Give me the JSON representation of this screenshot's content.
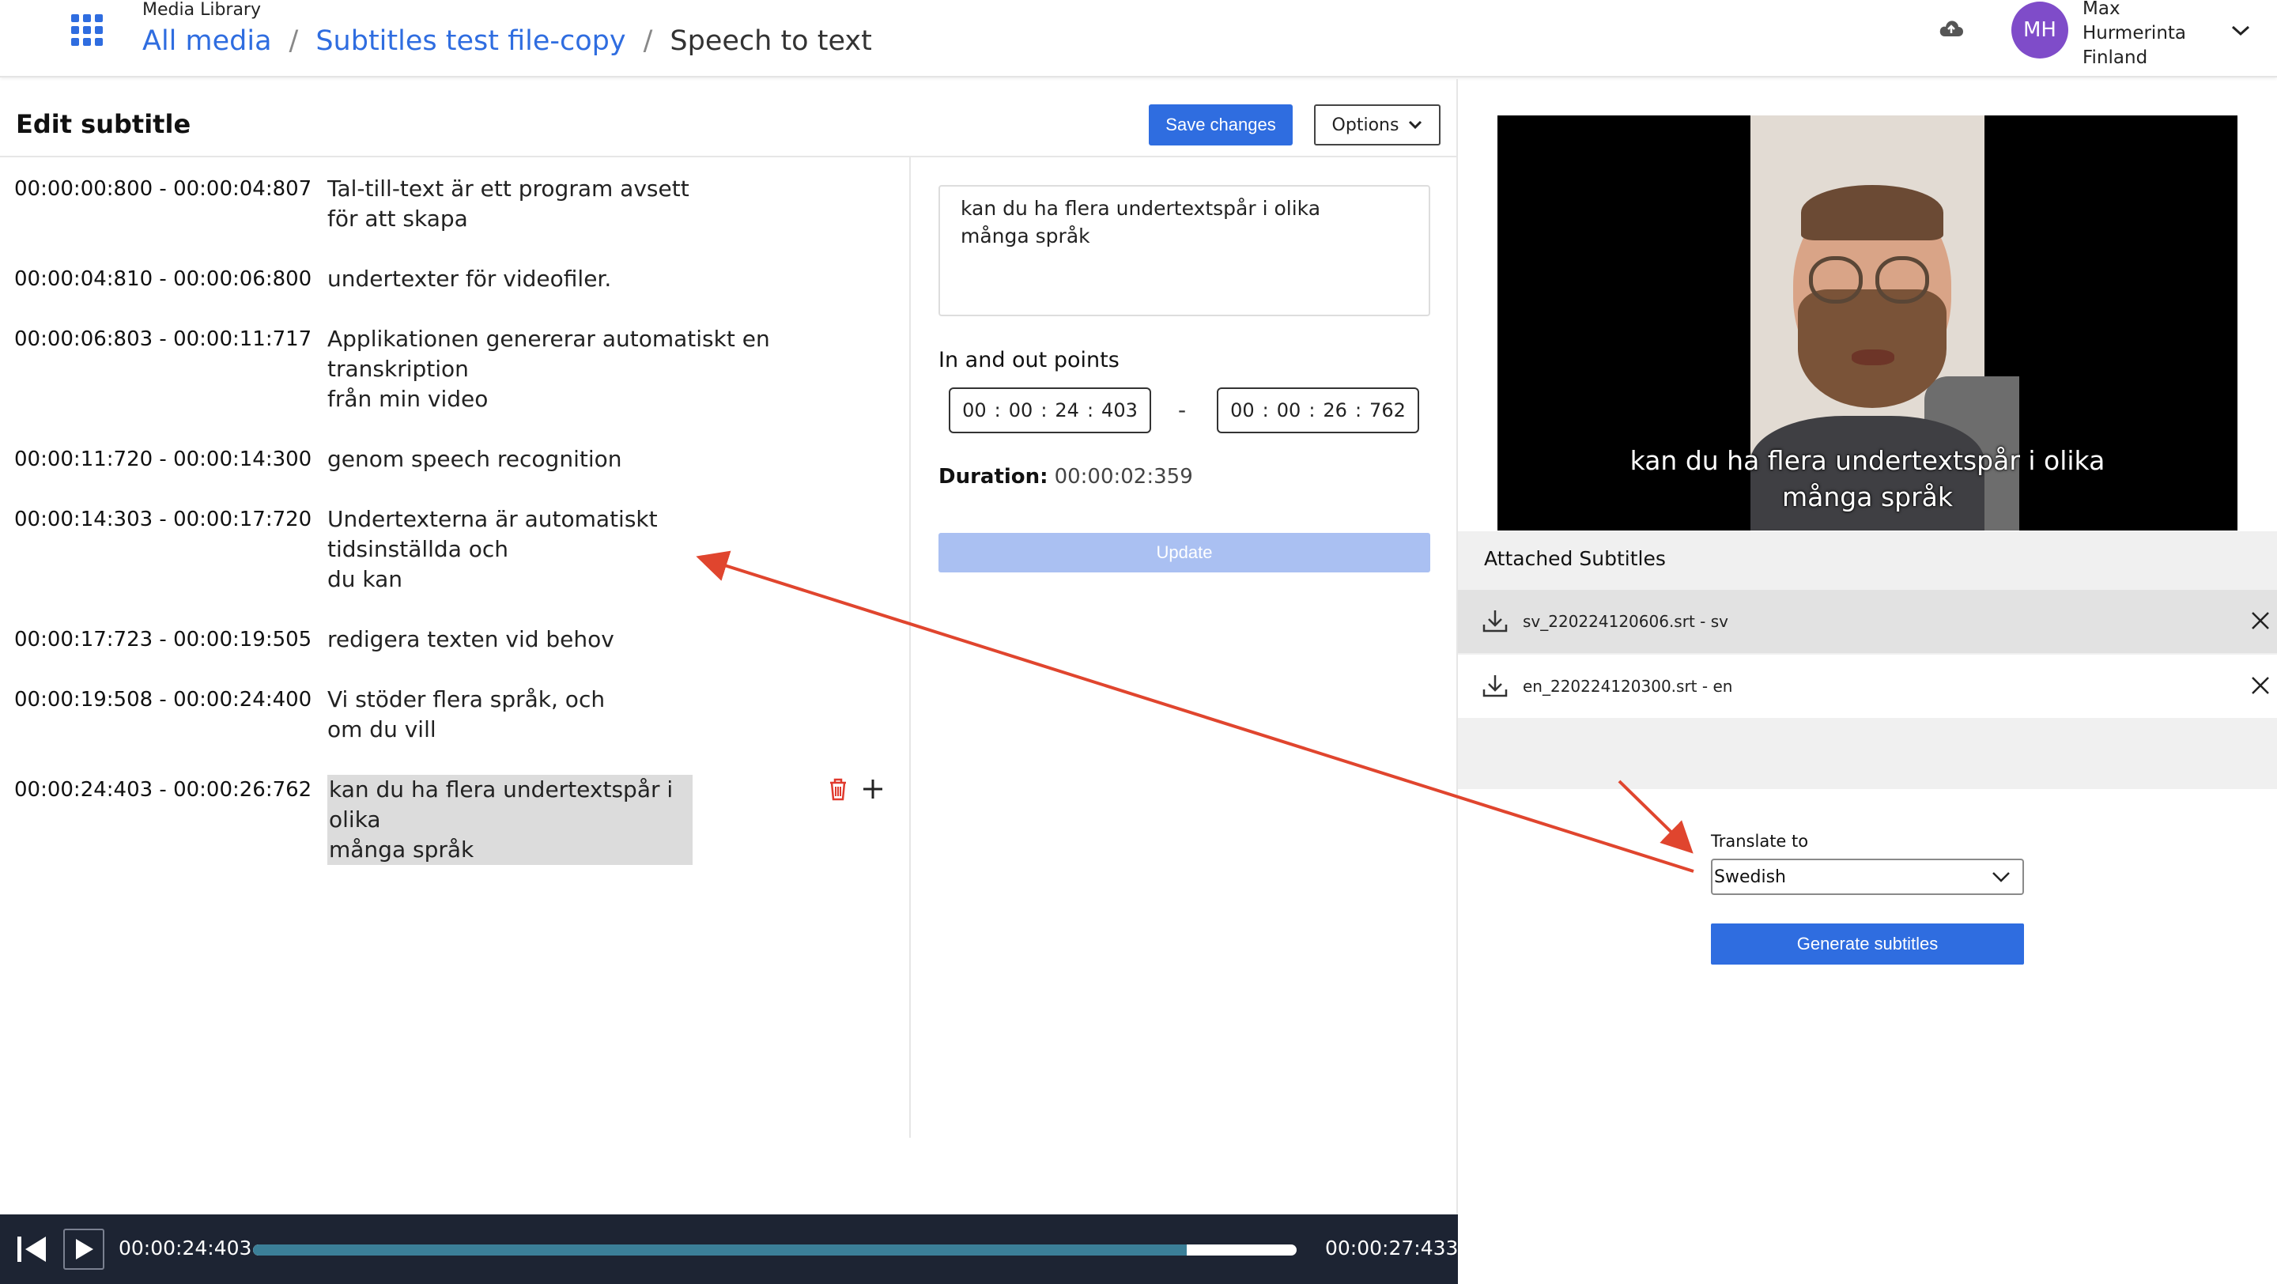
{
  "header": {
    "app_name": "Media Library",
    "breadcrumb": {
      "crumb1": "All media",
      "crumb2": "Subtitles test file-copy",
      "current": "Speech to text",
      "separator": "/"
    },
    "user": {
      "initials": "MH",
      "first_name": "Max",
      "last_name": "Hurmerinta",
      "country": "Finland"
    }
  },
  "editor": {
    "title": "Edit subtitle",
    "save_label": "Save changes",
    "options_label": "Options",
    "subtitles": [
      {
        "time": "00:00:00:800 - 00:00:04:807",
        "text": " Tal-till-text är ett program avsett\n för att skapa"
      },
      {
        "time": "00:00:04:810 - 00:00:06:800",
        "text": " undertexter för videofiler."
      },
      {
        "time": "00:00:06:803 - 00:00:11:717",
        "text": " Applikationen genererar automatiskt en\ntranskription\n från min video"
      },
      {
        "time": "00:00:11:720 - 00:00:14:300",
        "text": "genom speech recognition"
      },
      {
        "time": "00:00:14:303 - 00:00:17:720",
        "text": " Undertexterna är automatiskt\ntidsinställda och\n du kan"
      },
      {
        "time": "00:00:17:723 - 00:00:19:505",
        "text": " redigera texten vid behov"
      },
      {
        "time": "00:00:19:508 - 00:00:24:400",
        "text": " Vi stöder flera språk, och\n om du vill"
      },
      {
        "time": "00:00:24:403 - 00:00:26:762",
        "text": " kan du ha flera undertextspår i olika\n många språk"
      }
    ]
  },
  "detail": {
    "text": "kan du ha flera undertextspår i olika\nmånga språk",
    "points_label": "In and out points",
    "in_point": {
      "h": "00",
      "m": "00",
      "s": "24",
      "ms": "403"
    },
    "out_point": {
      "h": "00",
      "m": "00",
      "s": "26",
      "ms": "762"
    },
    "dash": "-",
    "duration_label": "Duration:",
    "duration_value": "00:00:02:359",
    "update_label": "Update"
  },
  "video": {
    "caption": "kan du ha flera undertextspår i olika\nmånga språk"
  },
  "attached": {
    "title": "Attached Subtitles",
    "files": [
      {
        "name": "sv_220224120606.srt - sv"
      },
      {
        "name": "en_220224120300.srt - en"
      }
    ]
  },
  "translate": {
    "label": "Translate to",
    "selected": "Swedish",
    "generate_label": "Generate subtitles"
  },
  "player": {
    "current_time": "00:00:24:403",
    "total_time": "00:00:27:433",
    "progress": 0.895
  },
  "colors": {
    "accent": "#2f6de0",
    "annotation": "#e0452e",
    "player_bg": "#1d2433",
    "progress_fill": "#3b7f98"
  },
  "icons": [
    "apps-grid-icon",
    "cloud-upload-icon",
    "chevron-down-icon",
    "trash-icon",
    "plus-icon",
    "download-icon",
    "close-icon",
    "skip-back-icon",
    "play-icon"
  ]
}
